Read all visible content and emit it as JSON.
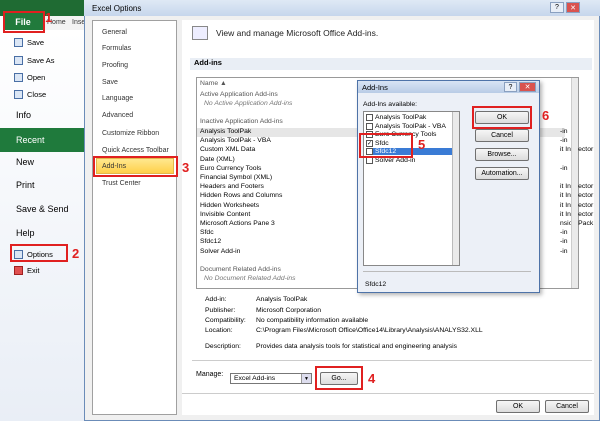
{
  "backstage": {
    "file_label": "File",
    "tabs_partial": [
      "Home",
      "Inse"
    ],
    "items": [
      {
        "label": "Save"
      },
      {
        "label": "Save As"
      },
      {
        "label": "Open"
      },
      {
        "label": "Close"
      }
    ],
    "info": "Info",
    "recent": "Recent",
    "new": "New",
    "print": "Print",
    "save_send": "Save & Send",
    "help": "Help",
    "options": "Options",
    "exit": "Exit"
  },
  "dialog": {
    "title": "Excel Options",
    "nav": [
      "General",
      "Formulas",
      "Proofing",
      "Save",
      "Language",
      "Advanced",
      "Customize Ribbon",
      "Quick Access Toolbar",
      "Add-Ins",
      "Trust Center"
    ],
    "header": "View and manage Microsoft Office Add-ins.",
    "section": "Add-ins",
    "col_name": "Name",
    "active_header": "Active Application Add-ins",
    "active_none": "No Active Application Add-ins",
    "inactive_header": "Inactive Application Add-ins",
    "inactive": [
      "Analysis ToolPak",
      "Analysis ToolPak - VBA",
      "Custom XML Data",
      "Date (XML)",
      "Euro Currency Tools",
      "Financial Symbol (XML)",
      "Headers and Footers",
      "Hidden Rows and Columns",
      "Hidden Worksheets",
      "Invisible Content",
      "Microsoft Actions Pane 3",
      "Sfdc",
      "Sfdc12",
      "Solver Add-in"
    ],
    "loc_fragments": [
      "-in",
      "-in",
      "it Inspector",
      "",
      "-in",
      "",
      "it Inspector",
      "it Inspector",
      "it Inspector",
      "it Inspector",
      "nsion Pack",
      "-in",
      "-in",
      "-in"
    ],
    "doc_header": "Document Related Add-ins",
    "doc_none": "No Document Related Add-ins",
    "details": {
      "addin_label": "Add-in:",
      "addin_value": "Analysis ToolPak",
      "publisher_label": "Publisher:",
      "publisher_value": "Microsoft Corporation",
      "compat_label": "Compatibility:",
      "compat_value": "No compatibility information available",
      "location_label": "Location:",
      "location_value": "C:\\Program Files\\Microsoft Office\\Office14\\Library\\Analysis\\ANALYS32.XLL",
      "desc_label": "Description:",
      "desc_value": "Provides data analysis tools for statistical and engineering analysis"
    },
    "manage_label": "Manage:",
    "manage_value": "Excel Add-ins",
    "go_label": "Go...",
    "ok_label": "OK",
    "cancel_label": "Cancel"
  },
  "addins_dialog": {
    "title": "Add-Ins",
    "help": "?",
    "available_label": "Add-Ins available:",
    "items": [
      {
        "label": "Analysis ToolPak",
        "checked": false
      },
      {
        "label": "Analysis ToolPak - VBA",
        "checked": false
      },
      {
        "label": "Euro Currency Tools",
        "checked": false
      },
      {
        "label": "Sfdc",
        "checked": true
      },
      {
        "label": "Sfdc12",
        "checked": true
      },
      {
        "label": "Solver Add-in",
        "checked": false
      }
    ],
    "ok": "OK",
    "cancel": "Cancel",
    "browse": "Browse...",
    "automation": "Automation...",
    "description": "Sfdc12"
  },
  "annotations": [
    "1",
    "2",
    "3",
    "4",
    "5",
    "6"
  ],
  "colors": {
    "accent_green": "#1f7a3c",
    "annotation_red": "#e02020",
    "selection_yellow": "#ffd04a"
  }
}
